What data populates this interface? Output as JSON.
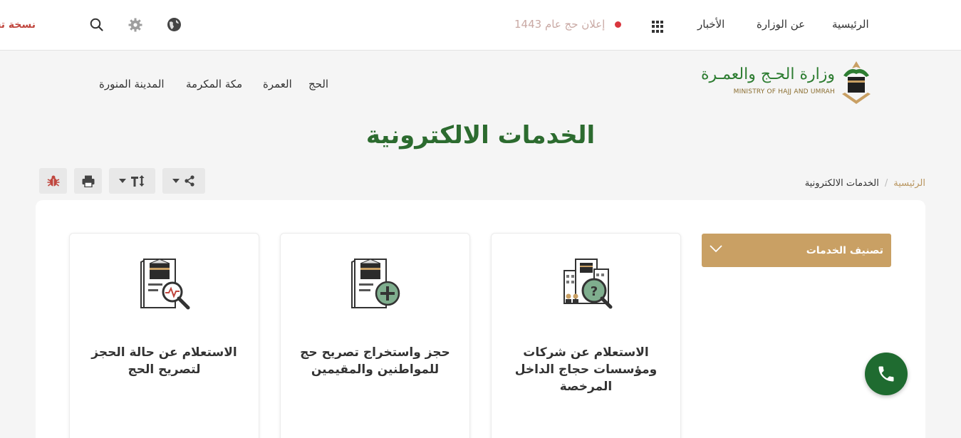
{
  "topbar": {
    "nav": {
      "home": "الرئيسية",
      "about": "عن الوزارة",
      "news": "الأخبار"
    },
    "announcement": "إعلان حج عام 1443",
    "old_version": "نسخة تجريبية",
    "colors": {
      "announcement_dot": "#d9363e"
    }
  },
  "logo": {
    "arabic": "وزارة الحـج والعمـرة",
    "english": "MINISTRY OF HAJJ AND UMRAH"
  },
  "subnav": {
    "hajj": "الحج",
    "umrah": "العمرة",
    "makkah": "مكة المكرمة",
    "madinah": "المدينة المنورة"
  },
  "page_title": "الخدمات الالكترونية",
  "breadcrumb": {
    "home": "الرئيسية",
    "separator": "/",
    "current": "الخدمات الالكترونية"
  },
  "toolbar": {
    "share": "share-icon",
    "font_size": "text-size-icon",
    "print": "print-icon",
    "bug": "bug-icon"
  },
  "filter": {
    "label": "تصنيف الخدمات",
    "color": "#c9a064"
  },
  "services": [
    {
      "title": "الاستعلام عن شركات ومؤسسات حجاج الداخل المرخصة",
      "icon": "building-inquiry-icon"
    },
    {
      "title": "حجز واستخراج تصريح حج للمواطنين والمقيمين",
      "icon": "document-add-icon"
    },
    {
      "title": "الاستعلام عن حالة الحجز لتصريح الحج",
      "icon": "document-search-icon"
    }
  ],
  "colors": {
    "brand_green": "#2c6b2f",
    "gold": "#c9a064",
    "call_button": "#1f6b30"
  }
}
